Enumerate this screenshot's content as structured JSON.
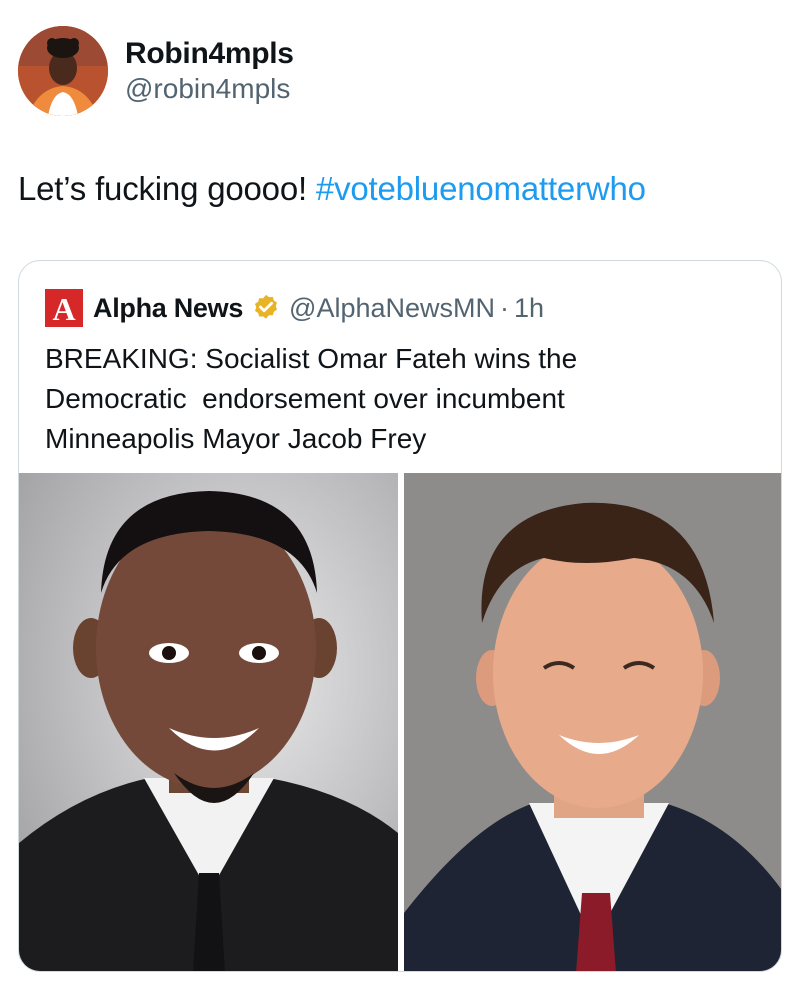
{
  "tweet": {
    "author": {
      "display_name": "Robin4mpls",
      "handle": "@robin4mpls"
    },
    "text": "Let’s fucking goooo! ",
    "hashtag": "#votebluenomatterwho"
  },
  "quoted_tweet": {
    "source_name": "Alpha News",
    "verified": true,
    "handle": "@AlphaNewsMN",
    "separator": "·",
    "time": "1h",
    "text_lines": [
      "BREAKING: Socialist Omar Fateh wins the",
      "Democratic  endorsement over incumbent",
      "Minneapolis Mayor Jacob Frey"
    ],
    "logo_letter": "A"
  },
  "icons": {
    "avatar": "avatar-photo",
    "verified": "verified-badge-icon",
    "logo": "alpha-news-logo-icon"
  },
  "colors": {
    "hashtag": "#1d9bf0",
    "secondary_text": "#536471",
    "verified_gold": "#e8b425",
    "logo_red": "#d62828"
  }
}
